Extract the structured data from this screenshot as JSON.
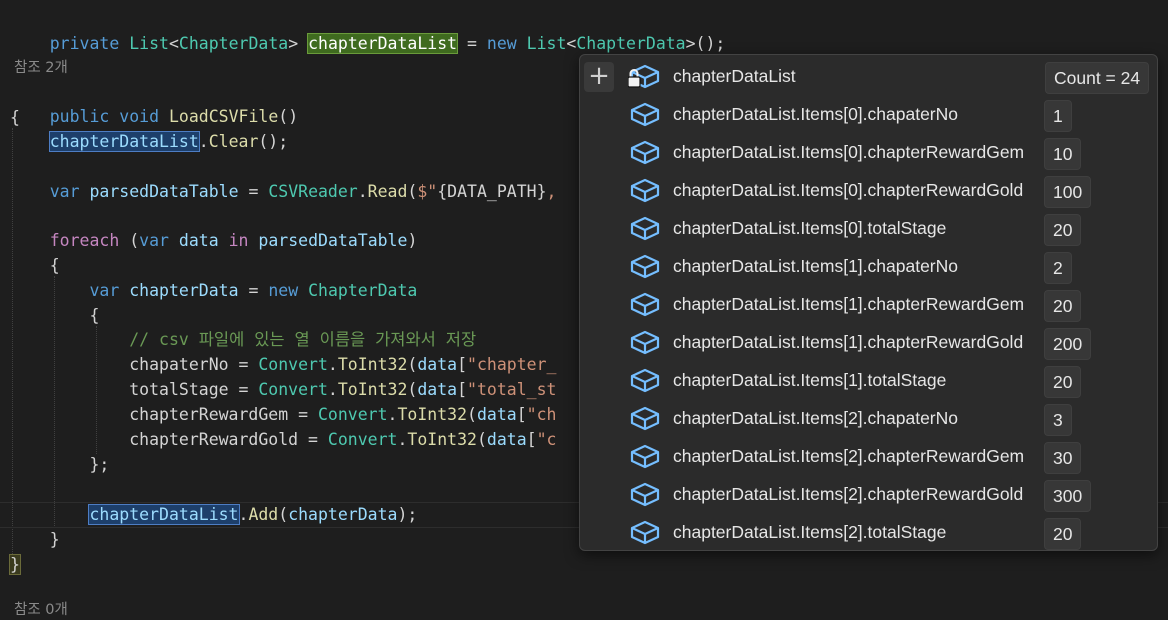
{
  "code": {
    "field_decl": {
      "private": "private",
      "list1": "List",
      "lt1": "<",
      "type1": "ChapterData",
      "gt1": ">",
      "name": "chapterDataList",
      "eq": " = ",
      "new": "new",
      "list2": "List",
      "lt2": "<",
      "type2": "ChapterData",
      "tail": ">();"
    },
    "codelens1": "참조 2개",
    "method_decl": {
      "public": "public",
      "void": "void",
      "name": "LoadCSVFile",
      "parens": "()"
    },
    "open_brace": "{",
    "clear_line": {
      "obj": "chapterDataList",
      "dot": ".",
      "method": "Clear",
      "tail": "();"
    },
    "parse_line": {
      "var": "var",
      "name": "parsedDataTable",
      "eq": " = ",
      "cls": "CSVReader",
      "dot": ".",
      "method": "Read",
      "open": "(",
      "interp": "$\"",
      "expr": "{DATA_PATH}",
      "tail": ","
    },
    "foreach_line": {
      "foreach": "foreach",
      "open": " (",
      "var": "var",
      "item": "data",
      "in": "in",
      "coll": "parsedDataTable",
      "close": ")"
    },
    "foreach_open": "{",
    "new_line": {
      "var": "var",
      "name": "chapterData",
      "eq": " = ",
      "new": "new",
      "type": "ChapterData"
    },
    "init_open": "{",
    "comment": "// csv 파일에 있는 열 이름을 가져와서 저장",
    "assign1": {
      "prop": "chapaterNo",
      "eq": " = ",
      "cls": "Convert",
      "dot": ".",
      "method": "ToInt32",
      "open": "(",
      "var": "data",
      "br": "[",
      "str": "\"chapter_"
    },
    "assign2": {
      "prop": "totalStage",
      "eq": " = ",
      "cls": "Convert",
      "dot": ".",
      "method": "ToInt32",
      "open": "(",
      "var": "data",
      "br": "[",
      "str": "\"total_st"
    },
    "assign3": {
      "prop": "chapterRewardGem",
      "eq": " = ",
      "cls": "Convert",
      "dot": ".",
      "method": "ToInt32",
      "open": "(",
      "var": "data",
      "br": "[",
      "str": "\"ch"
    },
    "assign4": {
      "prop": "chapterRewardGold",
      "eq": " = ",
      "cls": "Convert",
      "dot": ".",
      "method": "ToInt32",
      "open": "(",
      "var": "data",
      "br": "[",
      "str": "\"c"
    },
    "init_close": "};",
    "add_line": {
      "obj": "chapterDataList",
      "dot": ".",
      "method": "Add",
      "open": "(",
      "arg": "chapterData",
      "tail": ");"
    },
    "foreach_close": "}",
    "method_close": "}",
    "codelens2": "참조 0개"
  },
  "datatip": {
    "add_button": "+",
    "rows": [
      {
        "name": "chapterDataList",
        "value": "Count = 24"
      },
      {
        "name": "chapterDataList.Items[0].chapaterNo",
        "value": "1"
      },
      {
        "name": "chapterDataList.Items[0].chapterRewardGem",
        "value": "10"
      },
      {
        "name": "chapterDataList.Items[0].chapterRewardGold",
        "value": "100"
      },
      {
        "name": "chapterDataList.Items[0].totalStage",
        "value": "20"
      },
      {
        "name": "chapterDataList.Items[1].chapaterNo",
        "value": "2"
      },
      {
        "name": "chapterDataList.Items[1].chapterRewardGem",
        "value": "20"
      },
      {
        "name": "chapterDataList.Items[1].chapterRewardGold",
        "value": "200"
      },
      {
        "name": "chapterDataList.Items[1].totalStage",
        "value": "20"
      },
      {
        "name": "chapterDataList.Items[2].chapaterNo",
        "value": "3"
      },
      {
        "name": "chapterDataList.Items[2].chapterRewardGem",
        "value": "30"
      },
      {
        "name": "chapterDataList.Items[2].chapterRewardGold",
        "value": "300"
      },
      {
        "name": "chapterDataList.Items[2].totalStage",
        "value": "20"
      }
    ],
    "icons": {
      "field": "field-object-icon",
      "lock": "lock-icon"
    }
  },
  "colors": {
    "editor_bg": "#1e1e1e",
    "keyword": "#569cd6",
    "type": "#4ec9b0",
    "method": "#dcdcaa",
    "variable": "#9cdcfe",
    "string": "#ce9178",
    "comment": "#6a9955",
    "tooltip_bg": "#2b2b2b",
    "icon_blue": "#75beff"
  }
}
